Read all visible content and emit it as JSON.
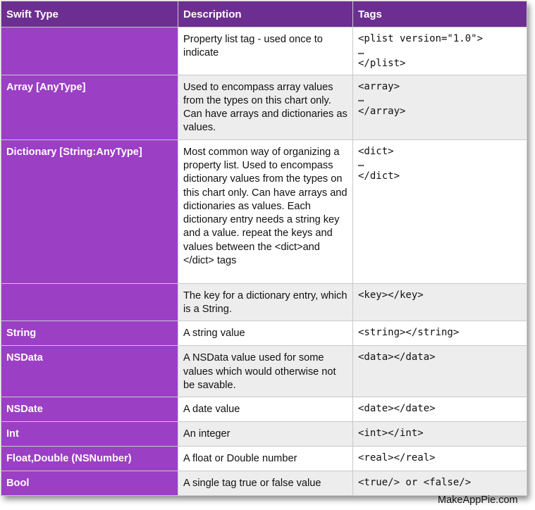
{
  "table": {
    "headers": [
      "Swift Type",
      "Description",
      "Tags"
    ],
    "rows": [
      {
        "type": "",
        "description": "Property list tag - used once to indicate",
        "tags": [
          "<plist version=\"1.0\">",
          "…",
          "</plist>"
        ]
      },
      {
        "type": "Array [AnyType]",
        "description": "Used to encompass array values from the types on this chart only. Can have arrays and dictionaries as values.",
        "tags": [
          "<array>",
          "…",
          "</array>"
        ]
      },
      {
        "type": "Dictionary [String:AnyType]",
        "description": "Most common way of organizing a property list. Used to encompass dictionary values from the types on this chart only. Can have arrays and dictionaries as values. Each dictionary entry needs a string key and a value. repeat the keys and values between the <dict>and </dict> tags",
        "tags": [
          "<dict>",
          "…",
          "</dict>"
        ]
      },
      {
        "type": "",
        "description": "The key for a dictionary entry, which is  a String.",
        "tags": [
          "<key></key>"
        ]
      },
      {
        "type": "String",
        "description": "A string value",
        "tags": [
          "<string></string>"
        ]
      },
      {
        "type": "NSData",
        "description": "A NSData value used for some values which would otherwise not be savable.",
        "tags": [
          "<data></data>"
        ]
      },
      {
        "type": "NSDate",
        "description": "A date value",
        "tags": [
          "<date></date>"
        ]
      },
      {
        "type": "Int",
        "description": "An integer",
        "tags": [
          "<int></int>"
        ]
      },
      {
        "type": "Float,Double (NSNumber)",
        "description": "A float or Double number",
        "tags": [
          "<real></real>"
        ]
      },
      {
        "type": "Bool",
        "description": "A single tag true or false value",
        "tags": [
          "<true/> or <false/>"
        ]
      }
    ]
  },
  "footer": {
    "credit": "MakeAppPie.com"
  },
  "colors": {
    "header_bg": "#6d2e91",
    "type_cell_bg": "#9b3fc4",
    "alt_row_bg": "#ededed"
  }
}
